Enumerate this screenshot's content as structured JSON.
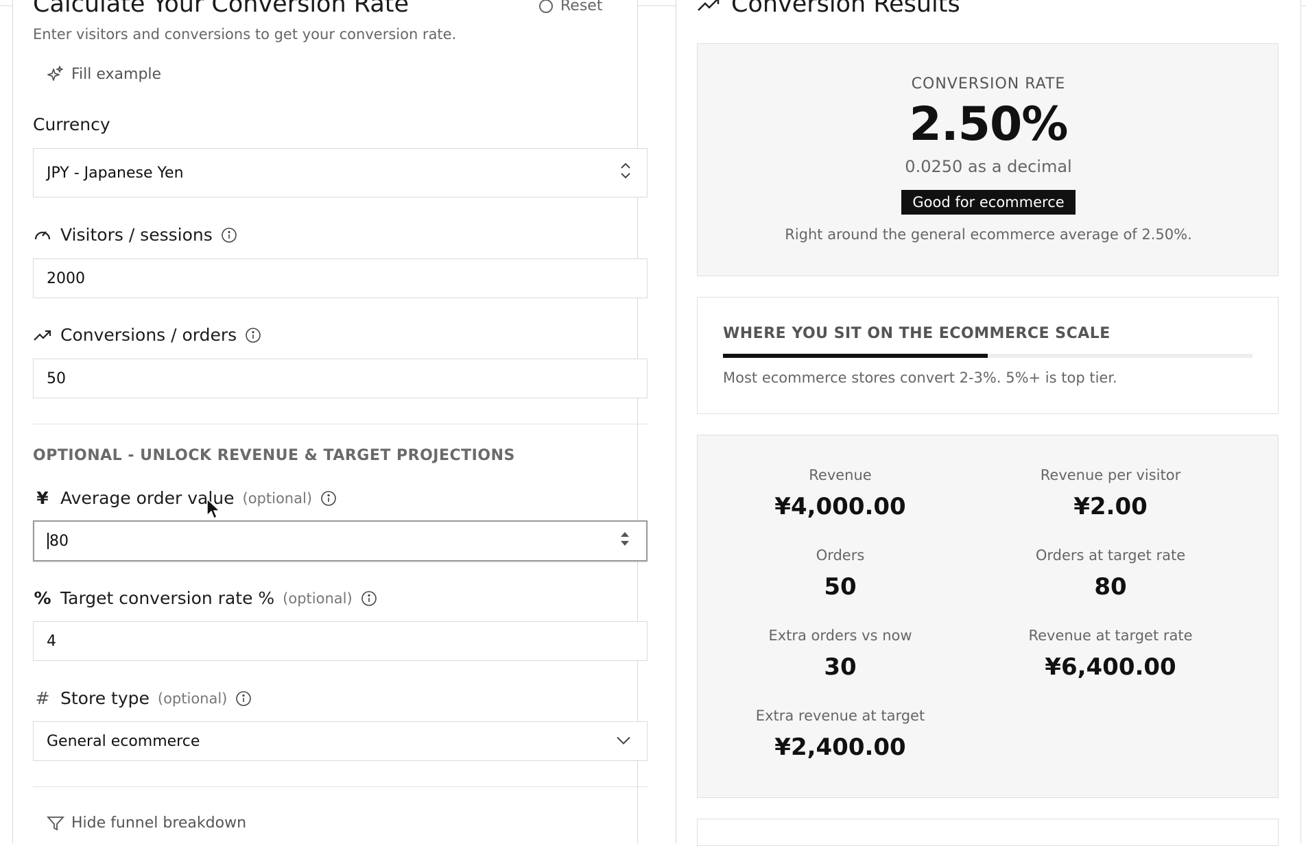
{
  "calculator": {
    "title": "Calculate Your Conversion Rate",
    "reset_label": "Reset",
    "subtitle": "Enter visitors and conversions to get your conversion rate.",
    "fill_example_label": "Fill example",
    "currency": {
      "label": "Currency",
      "value": "JPY - Japanese Yen"
    },
    "visitors": {
      "label": "Visitors / sessions",
      "value": "2000"
    },
    "conversions": {
      "label": "Conversions / orders",
      "value": "50"
    },
    "optional_heading": "OPTIONAL - UNLOCK REVENUE & TARGET PROJECTIONS",
    "aov": {
      "symbol": "¥",
      "label": "Average order value",
      "optional": "(optional)",
      "value": "80"
    },
    "target_rate": {
      "symbol": "%",
      "label": "Target conversion rate %",
      "optional": "(optional)",
      "value": "4"
    },
    "store_type": {
      "symbol": "#",
      "label": "Store type",
      "optional": "(optional)",
      "value": "General ecommerce"
    },
    "funnel_toggle_label": "Hide funnel breakdown"
  },
  "results": {
    "title": "Conversion Results",
    "rate_label": "CONVERSION RATE",
    "rate_value": "2.50%",
    "decimal_text": "0.0250 as a decimal",
    "badge": "Good for ecommerce",
    "note": "Right around the general ecommerce average of 2.50%.",
    "scale": {
      "heading": "WHERE YOU SIT ON THE ECOMMERCE SCALE",
      "position_fraction": 0.5,
      "note": "Most ecommerce stores convert 2-3%. 5%+ is top tier."
    },
    "metrics": [
      {
        "label": "Revenue",
        "value": "¥4,000.00"
      },
      {
        "label": "Revenue per visitor",
        "value": "¥2.00"
      },
      {
        "label": "Orders",
        "value": "50"
      },
      {
        "label": "Orders at target rate",
        "value": "80"
      },
      {
        "label": "Extra orders vs now",
        "value": "30"
      },
      {
        "label": "Revenue at target rate",
        "value": "¥6,400.00"
      },
      {
        "label": "Extra revenue at target",
        "value": "¥2,400.00"
      }
    ]
  },
  "colors": {
    "accent": "#111111",
    "muted": "#666666",
    "card_bg": "#f6f6f6",
    "border": "#dadada"
  }
}
